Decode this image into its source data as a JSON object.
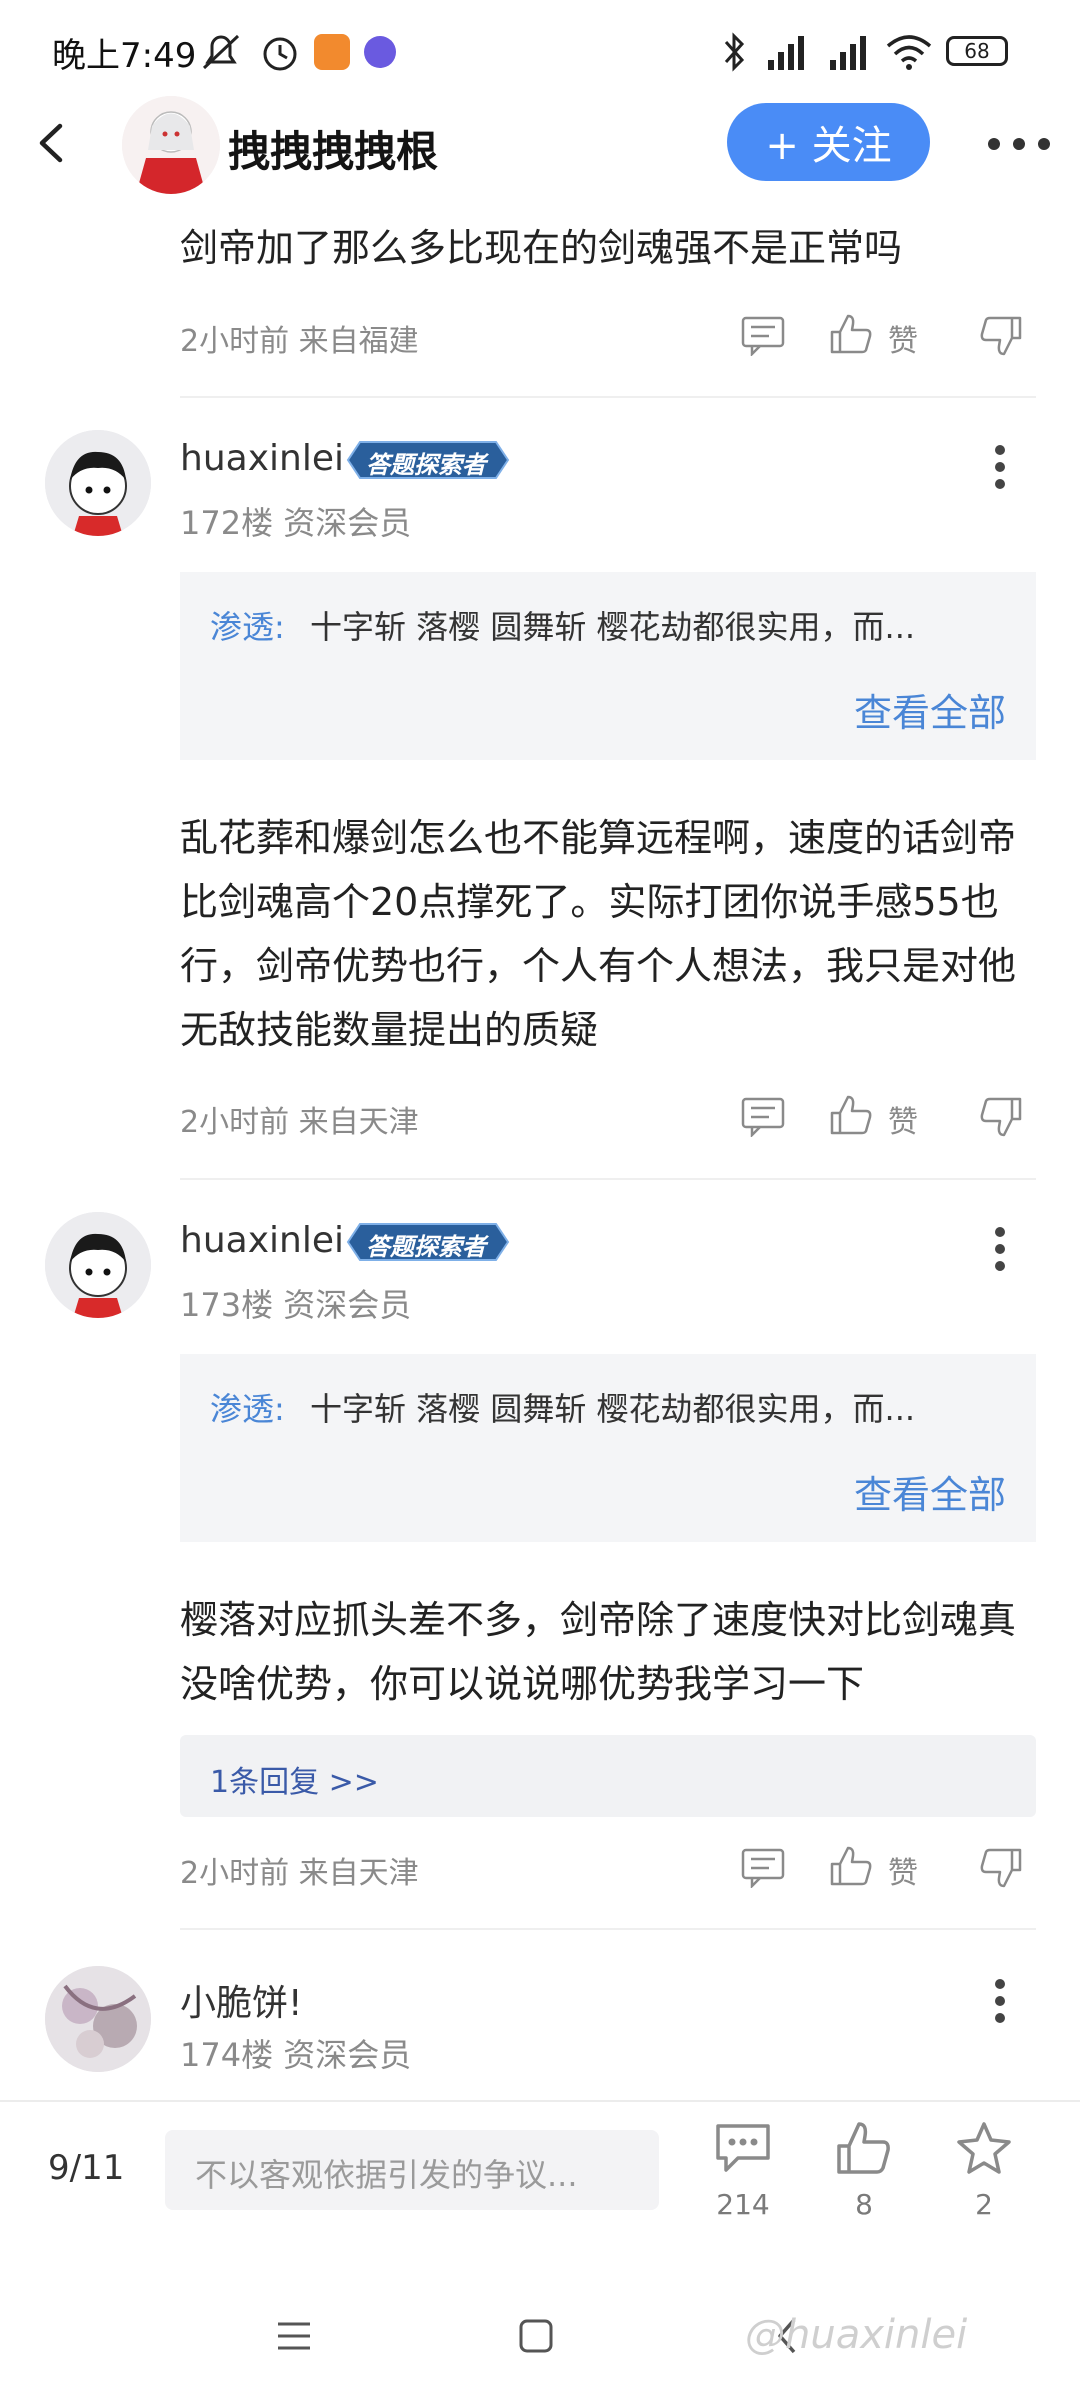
{
  "status_bar": {
    "time": "晚上7:49",
    "battery": "68"
  },
  "header": {
    "title": "拽拽拽拽根",
    "follow_label": "+ 关注"
  },
  "top_post": {
    "text": "剑帝加了那么多比现在的剑魂强不是正常吗",
    "meta": "2小时前 来自福建",
    "like_label": "赞"
  },
  "posts": [
    {
      "username": "huaxinlei",
      "badge": "答题探索者",
      "floor": "172楼 资深会员",
      "quote_author": "渗透:",
      "quote_text": "十字斩  落樱 圆舞斩 樱花劫都很实用，而...",
      "quote_more": "查看全部",
      "text": "乱花葬和爆剑怎么也不能算远程啊，速度的话剑帝比剑魂高个20点撑死了。实际打团你说手感55也行，剑帝优势也行，个人有个人想法，我只是对他无敌技能数量提出的质疑",
      "meta": "2小时前 来自天津",
      "like_label": "赞"
    },
    {
      "username": "huaxinlei",
      "badge": "答题探索者",
      "floor": "173楼 资深会员",
      "quote_author": "渗透:",
      "quote_text": "十字斩  落樱 圆舞斩 樱花劫都很实用，而...",
      "quote_more": "查看全部",
      "text": "樱落对应抓头差不多，剑帝除了速度快对比剑魂真没啥优势，你可以说说哪优势我学习一下",
      "replies": "1条回复 >>",
      "meta": "2小时前 来自天津",
      "like_label": "赞"
    },
    {
      "username": "小脆饼!",
      "floor": "174楼 资深会员"
    }
  ],
  "bottom_bar": {
    "page": "9/11",
    "input_placeholder": "不以客观依据引发的争议...",
    "comments": "214",
    "likes": "8",
    "stars": "2"
  },
  "watermark": "@huaxinlei",
  "icons": {
    "back": "chevron-left-icon",
    "more": "more-horizontal-icon",
    "reply": "comment-icon",
    "like": "thumb-up-icon",
    "dislike": "thumb-down-icon",
    "star": "star-icon",
    "menu": "menu-icon",
    "home": "square-icon",
    "nav-back": "chevron-left-icon"
  },
  "colors": {
    "accent": "#4a8cf6",
    "link": "#4a86d6"
  }
}
